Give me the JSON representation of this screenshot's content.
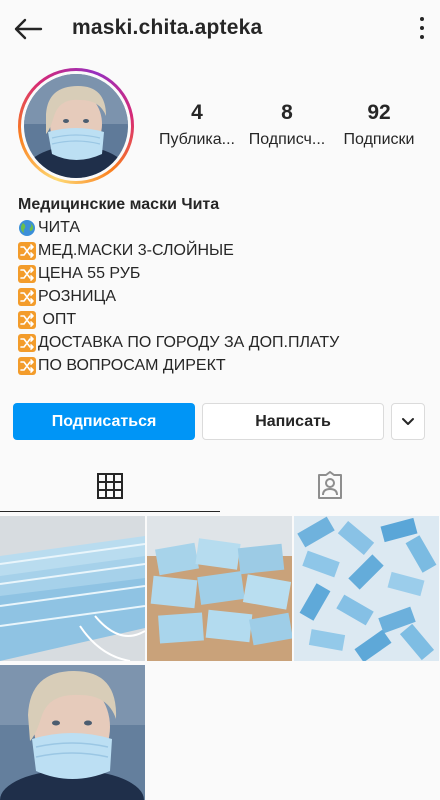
{
  "header": {
    "username": "maski.chita.apteka",
    "back_icon": "arrow-left-icon",
    "menu_icon": "more-vertical-icon"
  },
  "profile": {
    "stats": [
      {
        "count": "4",
        "label": "Публика..."
      },
      {
        "count": "8",
        "label": "Подписч..."
      },
      {
        "count": "92",
        "label": "Подписки"
      }
    ]
  },
  "bio": {
    "name": "Медицинские маски Чита",
    "lines": [
      {
        "icon": "globe-icon",
        "text": "ЧИТА"
      },
      {
        "icon": "shuffle-icon",
        "text": "МЕД.МАСКИ 3-СЛОЙНЫЕ"
      },
      {
        "icon": "shuffle-icon",
        "text": "ЦЕНА 55 РУБ"
      },
      {
        "icon": "shuffle-icon",
        "text": "РОЗНИЦА"
      },
      {
        "icon": "shuffle-icon",
        "text": " ОПТ"
      },
      {
        "icon": "shuffle-icon",
        "text": "ДОСТАВКА ПО ГОРОДУ ЗА ДОП.ПЛАТУ"
      },
      {
        "icon": "shuffle-icon",
        "text": "ПО ВОПРОСАМ ДИРЕКТ"
      }
    ]
  },
  "actions": {
    "follow_label": "Подписаться",
    "message_label": "Написать",
    "more_icon": "chevron-down-icon"
  },
  "tabs": [
    {
      "icon": "grid-icon",
      "active": true
    },
    {
      "icon": "tagged-person-icon",
      "active": false
    }
  ],
  "colors": {
    "accent": "#0095f6",
    "text": "#262626",
    "border": "#dbdbdb",
    "background": "#fafafa"
  }
}
